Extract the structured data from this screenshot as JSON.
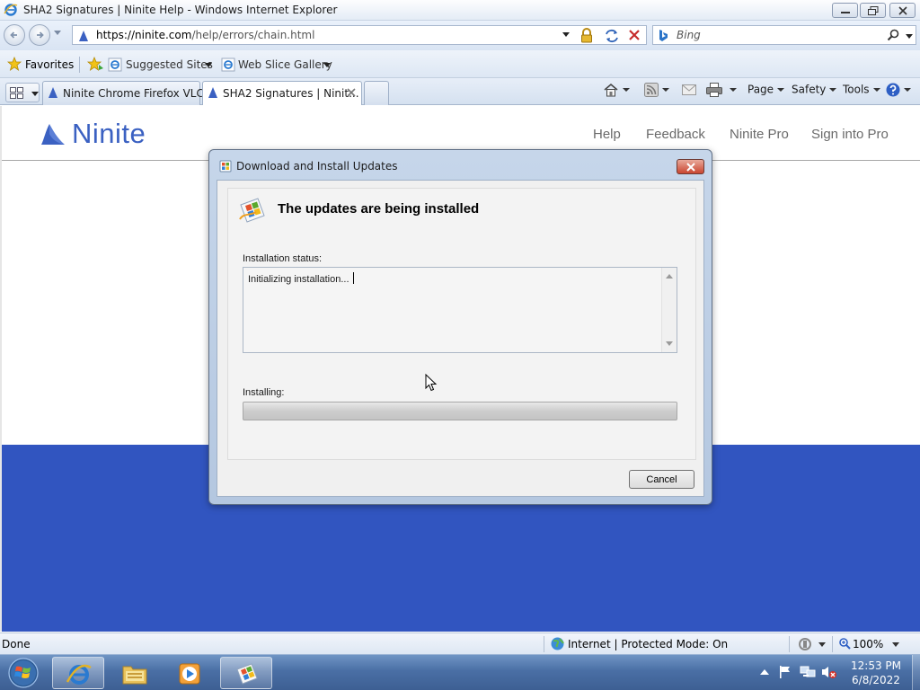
{
  "window": {
    "title": "SHA2 Signatures | Ninite Help - Windows Internet Explorer"
  },
  "address_bar": {
    "url_host": "https://ninite.com",
    "url_path": "/help/errors/chain.html"
  },
  "search": {
    "placeholder": "Bing"
  },
  "favorites_bar": {
    "favorites_label": "Favorites",
    "suggested_sites": "Suggested Sites",
    "web_slice_gallery": "Web Slice Gallery"
  },
  "tabs": [
    {
      "label": "Ninite Chrome Firefox VLC..."
    },
    {
      "label": "SHA2 Signatures | Ninit..."
    }
  ],
  "command_bar": {
    "page": "Page",
    "safety": "Safety",
    "tools": "Tools"
  },
  "site": {
    "logo": "Ninite",
    "nav": [
      "Help",
      "Feedback",
      "Ninite Pro",
      "Sign into Pro"
    ]
  },
  "dialog": {
    "title": "Download and Install Updates",
    "heading": "The updates are being installed",
    "status_label": "Installation status:",
    "status_text": "Initializing installation...",
    "installing_label": "Installing:",
    "progress_fraction": 0.0,
    "cancel_label": "Cancel"
  },
  "status_bar": {
    "left_text": "Done",
    "zone_text": "Internet | Protected Mode: On",
    "zoom": "100%"
  },
  "taskbar": {
    "time": "12:53 PM",
    "date": "6/8/2022"
  },
  "colors": {
    "ninite_blue": "#3155c0",
    "logo_blue": "#3b61c2",
    "progress_green": "#3cb024"
  }
}
